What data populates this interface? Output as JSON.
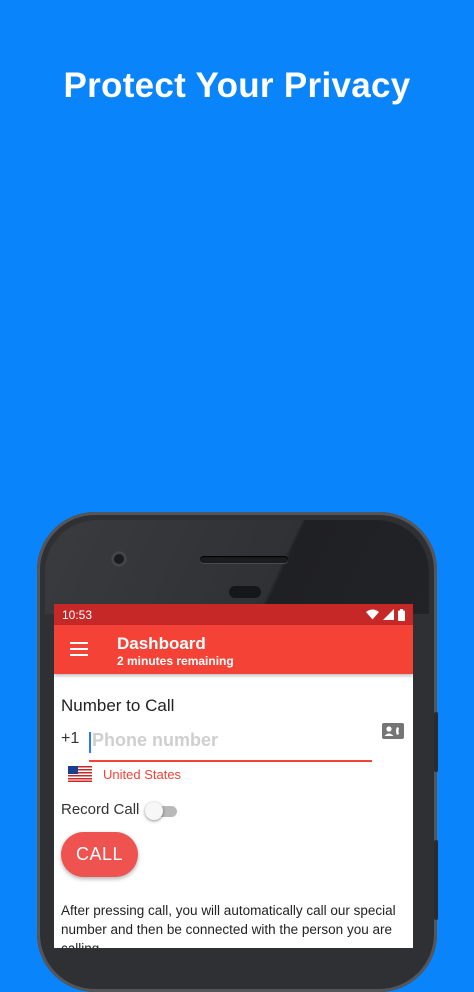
{
  "headline": "Protect Your Privacy",
  "status_bar": {
    "time": "10:53"
  },
  "app_bar": {
    "title": "Dashboard",
    "subtitle": "2 minutes remaining"
  },
  "form": {
    "section_title": "Number to Call",
    "country_code": "+1",
    "phone_placeholder": "Phone number",
    "phone_value": "",
    "country_name": "United States",
    "record_label": "Record Call",
    "record_enabled": false,
    "call_label": "CALL"
  },
  "info_text": "After pressing call, you will automatically call our special number and then be connected with the person you are calling.",
  "colors": {
    "background": "#0a84fb",
    "status_bar": "#c62828",
    "app_bar": "#f44336",
    "accent": "#ef5350"
  },
  "icons": [
    "menu-icon",
    "wifi-icon",
    "signal-icon",
    "battery-icon",
    "contact-card-icon",
    "us-flag-icon"
  ]
}
